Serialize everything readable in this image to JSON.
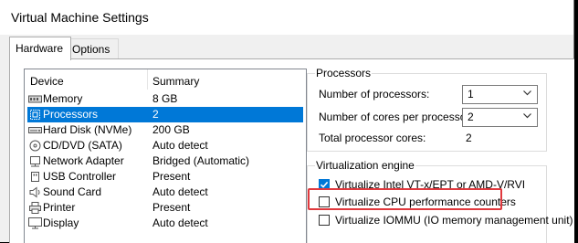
{
  "window": {
    "title": "Virtual Machine Settings"
  },
  "tabs": [
    {
      "label": "Hardware",
      "active": true
    },
    {
      "label": "Options",
      "active": false
    }
  ],
  "device_list": {
    "columns": {
      "device": "Device",
      "summary": "Summary"
    },
    "rows": [
      {
        "icon": "memory-icon",
        "device": "Memory",
        "summary": "8 GB"
      },
      {
        "icon": "processor-icon",
        "device": "Processors",
        "summary": "2",
        "selected": true
      },
      {
        "icon": "hard-disk-icon",
        "device": "Hard Disk (NVMe)",
        "summary": "200 GB"
      },
      {
        "icon": "cd-dvd-icon",
        "device": "CD/DVD (SATA)",
        "summary": "Auto detect"
      },
      {
        "icon": "network-adapter-icon",
        "device": "Network Adapter",
        "summary": "Bridged (Automatic)"
      },
      {
        "icon": "usb-controller-icon",
        "device": "USB Controller",
        "summary": "Present"
      },
      {
        "icon": "sound-card-icon",
        "device": "Sound Card",
        "summary": "Auto detect"
      },
      {
        "icon": "printer-icon",
        "device": "Printer",
        "summary": "Present"
      },
      {
        "icon": "display-icon",
        "device": "Display",
        "summary": "Auto detect"
      }
    ]
  },
  "processors": {
    "title": "Processors",
    "num_processors_label": "Number of processors:",
    "num_processors_value": "1",
    "cores_label": "Number of cores per processor:",
    "cores_value": "2",
    "total_label": "Total processor cores:",
    "total_value": "2"
  },
  "virtualization": {
    "title": "Virtualization engine",
    "options": [
      {
        "label": "Virtualize Intel VT-x/EPT or AMD-V/RVI",
        "checked": true
      },
      {
        "label": "Virtualize CPU performance counters",
        "checked": false,
        "highlighted": true
      },
      {
        "label": "Virtualize IOMMU (IO memory management unit)",
        "checked": false
      }
    ]
  },
  "colors": {
    "selection": "#0078d7",
    "highlight_border": "#e0393e",
    "checkbox_checked": "#0078d7"
  }
}
